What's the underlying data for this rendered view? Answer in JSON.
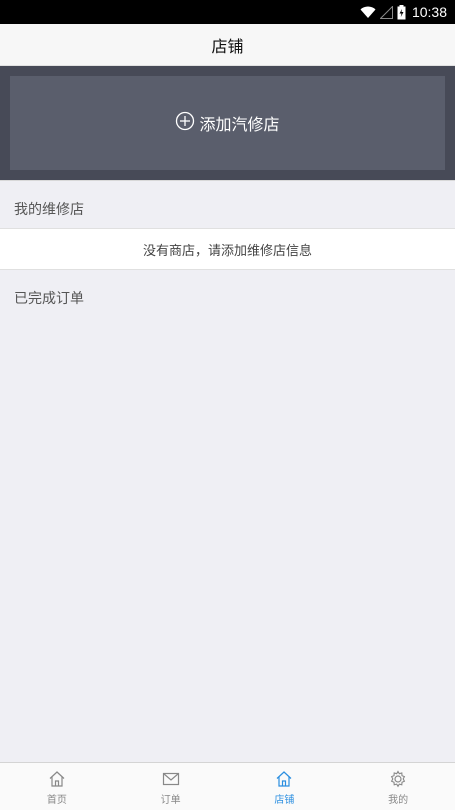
{
  "status_bar": {
    "time": "10:38",
    "icons": [
      "wifi-icon",
      "signal-icon",
      "battery-icon"
    ]
  },
  "header": {
    "title": "店铺"
  },
  "hero": {
    "add_label": "添加汽修店",
    "icon": "plus-circle-icon"
  },
  "sections": {
    "my_shops_title": "我的维修店",
    "empty_message": "没有商店，请添加维修店信息",
    "completed_orders_title": "已完成订单"
  },
  "tabs": [
    {
      "label": "首页",
      "icon": "home-icon",
      "active": false
    },
    {
      "label": "订单",
      "icon": "mail-icon",
      "active": false
    },
    {
      "label": "店铺",
      "icon": "store-icon",
      "active": true
    },
    {
      "label": "我的",
      "icon": "gear-icon",
      "active": false
    }
  ],
  "colors": {
    "accent": "#2a8ee0",
    "hero_bg": "#474a57",
    "button_bg": "#5a5e6c"
  }
}
